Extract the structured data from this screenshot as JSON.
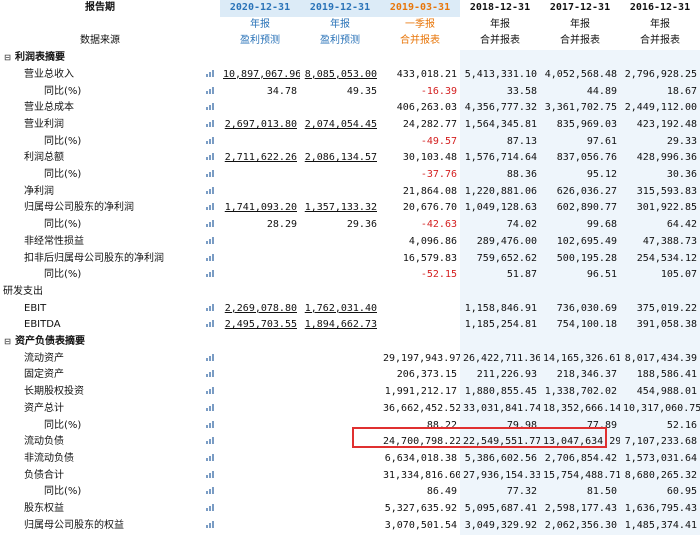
{
  "colors": {
    "accent_blue": "#2a73b8",
    "accent_orange": "#e8760a",
    "alert_red": "#d42020",
    "header_bg": "#dcebf7"
  },
  "header": {
    "row_label_1": "报告期",
    "row_label_2": "数据来源",
    "dates": [
      "2020-12-31",
      "2019-12-31",
      "2019-03-31",
      "2018-12-31",
      "2017-12-31",
      "2016-12-31"
    ],
    "periods": [
      "年报",
      "年报",
      "一季报",
      "年报",
      "年报",
      "年报"
    ],
    "sources": [
      "盈利预测",
      "盈利预测",
      "合并报表",
      "合并报表",
      "合并报表",
      "合并报表"
    ]
  },
  "rows": [
    {
      "label": "利润表摘要",
      "kind": "section",
      "toggle": "⊟",
      "values": [
        "",
        "",
        "",
        "",
        "",
        ""
      ]
    },
    {
      "label": "营业总收入",
      "kind": "item",
      "values": [
        "10,897,067.96",
        "8,085,053.00",
        "433,018.21",
        "5,413,331.10",
        "4,052,568.48",
        "2,796,928.25"
      ]
    },
    {
      "label": "同比(%)",
      "kind": "sub",
      "values": [
        "34.78",
        "49.35",
        "-16.39",
        "33.58",
        "44.89",
        "18.67"
      ]
    },
    {
      "label": "营业总成本",
      "kind": "item",
      "values": [
        "",
        "",
        "406,263.03",
        "4,356,777.32",
        "3,361,702.75",
        "2,449,112.00"
      ]
    },
    {
      "label": "营业利润",
      "kind": "item",
      "values": [
        "2,697,013.80",
        "2,074,054.45",
        "24,282.77",
        "1,564,345.81",
        "835,969.03",
        "423,192.48"
      ]
    },
    {
      "label": "同比(%)",
      "kind": "sub",
      "values": [
        "",
        "",
        "-49.57",
        "87.13",
        "97.61",
        "29.33"
      ]
    },
    {
      "label": "利润总额",
      "kind": "item",
      "values": [
        "2,711,622.26",
        "2,086,134.57",
        "30,103.48",
        "1,576,714.64",
        "837,056.76",
        "428,996.36"
      ]
    },
    {
      "label": "同比(%)",
      "kind": "sub",
      "values": [
        "",
        "",
        "-37.76",
        "88.36",
        "95.12",
        "30.36"
      ]
    },
    {
      "label": "净利润",
      "kind": "item",
      "values": [
        "",
        "",
        "21,864.08",
        "1,220,881.06",
        "626,036.27",
        "315,593.83"
      ]
    },
    {
      "label": "归属母公司股东的净利润",
      "kind": "item",
      "values": [
        "1,741,093.20",
        "1,357,133.32",
        "20,676.70",
        "1,049,128.63",
        "602,890.77",
        "301,922.85"
      ]
    },
    {
      "label": "同比(%)",
      "kind": "sub",
      "values": [
        "28.29",
        "29.36",
        "-42.63",
        "74.02",
        "99.68",
        "64.42"
      ]
    },
    {
      "label": "非经常性损益",
      "kind": "item",
      "values": [
        "",
        "",
        "4,096.86",
        "289,476.00",
        "102,695.49",
        "47,388.73"
      ]
    },
    {
      "label": "扣非后归属母公司股东的净利润",
      "kind": "item",
      "values": [
        "",
        "",
        "16,579.83",
        "759,652.62",
        "500,195.28",
        "254,534.12"
      ]
    },
    {
      "label": "同比(%)",
      "kind": "sub",
      "values": [
        "",
        "",
        "-52.15",
        "51.87",
        "96.51",
        "105.07"
      ]
    },
    {
      "label": "研发支出",
      "kind": "plain",
      "values": [
        "",
        "",
        "",
        "",
        "",
        ""
      ]
    },
    {
      "label": "EBIT",
      "kind": "item",
      "values": [
        "2,269,078.80",
        "1,762,031.40",
        "",
        "1,158,846.91",
        "736,030.69",
        "375,019.22"
      ]
    },
    {
      "label": "EBITDA",
      "kind": "item",
      "values": [
        "2,495,703.55",
        "1,894,662.73",
        "",
        "1,185,254.81",
        "754,100.18",
        "391,058.38"
      ]
    },
    {
      "label": "资产负债表摘要",
      "kind": "section",
      "toggle": "⊟",
      "values": [
        "",
        "",
        "",
        "",
        "",
        ""
      ]
    },
    {
      "label": "流动资产",
      "kind": "item",
      "values": [
        "",
        "",
        "29,197,943.97",
        "26,422,711.36",
        "14,165,326.61",
        "8,017,434.39"
      ]
    },
    {
      "label": "固定资产",
      "kind": "item",
      "values": [
        "",
        "",
        "206,373.15",
        "211,226.93",
        "218,346.37",
        "188,586.41"
      ]
    },
    {
      "label": "长期股权投资",
      "kind": "item",
      "values": [
        "",
        "",
        "1,991,212.17",
        "1,880,855.45",
        "1,338,702.02",
        "454,988.01"
      ]
    },
    {
      "label": "资产总计",
      "kind": "item",
      "values": [
        "",
        "",
        "36,662,452.52",
        "33,031,841.74",
        "18,352,666.14",
        "10,317,060.75"
      ]
    },
    {
      "label": "同比(%)",
      "kind": "sub",
      "values": [
        "",
        "",
        "88.22",
        "79.98",
        "77.89",
        "52.16"
      ]
    },
    {
      "label": "流动负债",
      "kind": "item",
      "values": [
        "",
        "",
        "24,700,798.22",
        "22,549,551.77",
        "13,047,634.29",
        "7,107,233.68"
      ]
    },
    {
      "label": "非流动负债",
      "kind": "item",
      "values": [
        "",
        "",
        "6,634,018.38",
        "5,386,602.56",
        "2,706,854.42",
        "1,573,031.64"
      ]
    },
    {
      "label": "负债合计",
      "kind": "item",
      "values": [
        "",
        "",
        "31,334,816.60",
        "27,936,154.33",
        "15,754,488.71",
        "8,680,265.32"
      ]
    },
    {
      "label": "同比(%)",
      "kind": "sub",
      "values": [
        "",
        "",
        "86.49",
        "77.32",
        "81.50",
        "60.95"
      ]
    },
    {
      "label": "股东权益",
      "kind": "item",
      "values": [
        "",
        "",
        "5,327,635.92",
        "5,095,687.41",
        "2,598,177.43",
        "1,636,795.43"
      ]
    },
    {
      "label": "归属母公司股东的权益",
      "kind": "item",
      "values": [
        "",
        "",
        "3,070,501.54",
        "3,049,329.92",
        "2,062,356.30",
        "1,485,374.41"
      ]
    }
  ],
  "icon_names": {
    "row_chart": "mini-chart-icon",
    "collapse": "collapse-toggle-icon"
  }
}
